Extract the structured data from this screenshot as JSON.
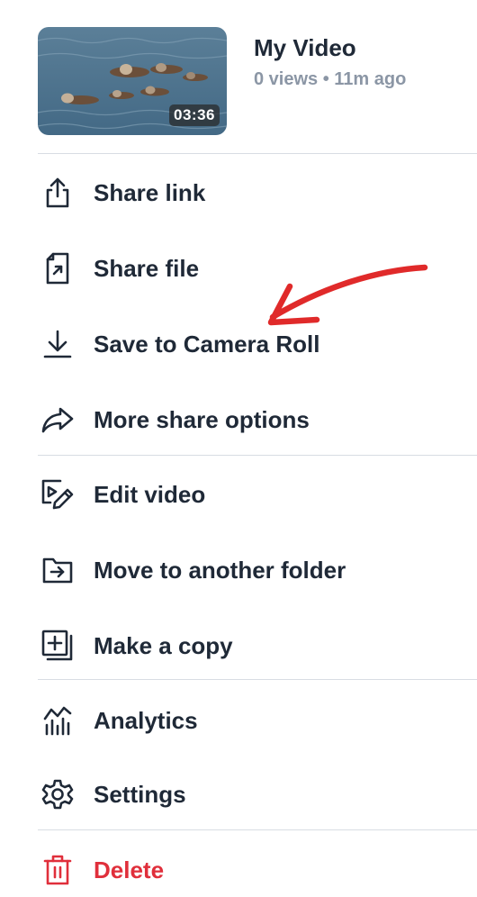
{
  "video": {
    "title": "My Video",
    "meta": "0 views • 11m ago",
    "duration": "03:36"
  },
  "menu": {
    "share_link": "Share link",
    "share_file": "Share file",
    "save_camera_roll": "Save to Camera Roll",
    "more_share": "More share options",
    "edit_video": "Edit video",
    "move_folder": "Move to another folder",
    "make_copy": "Make a copy",
    "analytics": "Analytics",
    "settings": "Settings",
    "delete": "Delete"
  },
  "colors": {
    "text": "#1f2937",
    "danger": "#e02f3b",
    "annotation": "#e02a2a"
  },
  "icons": [
    "share-icon",
    "share-file-icon",
    "download-icon",
    "forward-share-icon",
    "edit-video-icon",
    "move-folder-icon",
    "copy-icon",
    "analytics-icon",
    "gear-icon",
    "trash-icon"
  ]
}
